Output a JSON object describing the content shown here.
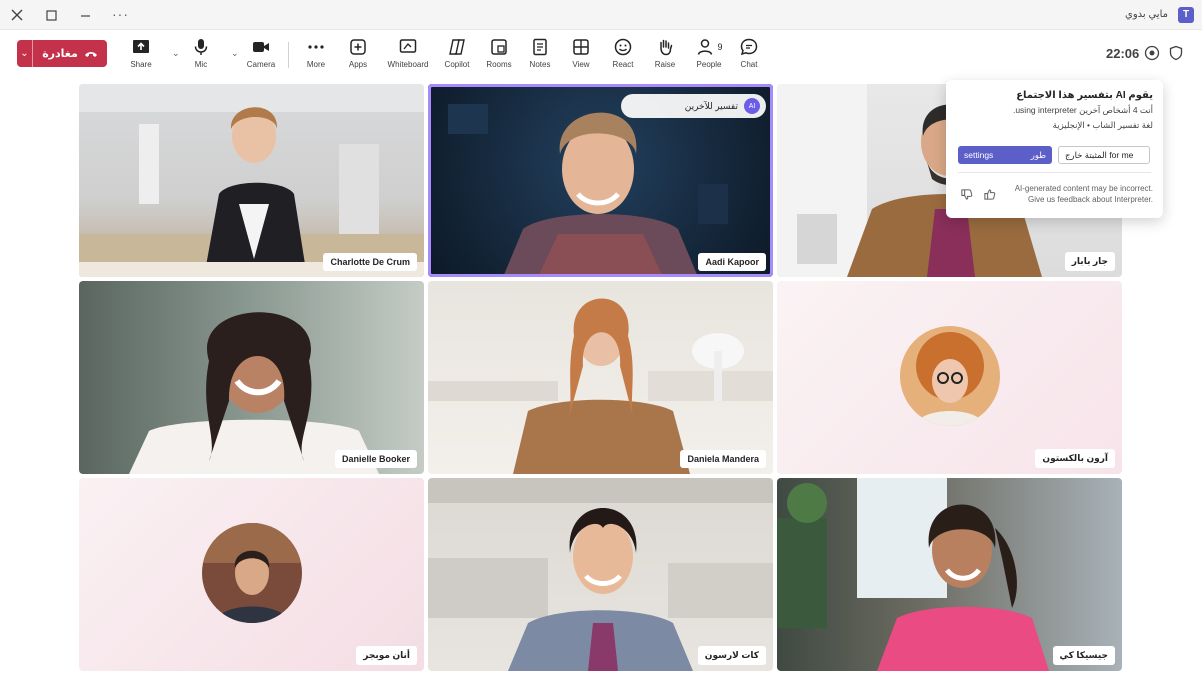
{
  "window": {
    "title": "مايي بدوي",
    "more": "···"
  },
  "toolbar": {
    "leave_label": "مغادرة",
    "share": "Share",
    "mic": "Mic",
    "camera": "Camera",
    "more": "More",
    "apps": "Apps",
    "whiteboard": "Whiteboard",
    "copilot": "Copilot",
    "rooms": "Rooms",
    "notes": "Notes",
    "view": "View",
    "react": "React",
    "raise": "Raise",
    "people": "People",
    "people_count": "9",
    "chat": "Chat",
    "timer": "22:06"
  },
  "tiles": [
    {
      "name": "Charlotte De Crum"
    },
    {
      "name": "Aadi Kapoor",
      "interpreter_pill": "تفسير للآخرين",
      "badge": "AI"
    },
    {
      "name": "جار بابار"
    },
    {
      "name": "Danielle Booker"
    },
    {
      "name": "Daniela Mandera"
    },
    {
      "name": "آرون بالكستون"
    },
    {
      "name": "أنان موبجر"
    },
    {
      "name": "كات لارسون"
    },
    {
      "name": "جيسيكا كي"
    }
  ],
  "popup": {
    "title": "يقوم AI بتفسير هذا الاجتماع",
    "line1": "أنت 4 أشخاص آخرين using interpreter.",
    "line2": "لغة تفسير الشاب • الإنجليزية",
    "btn_left": "المثبتة خارج for me",
    "btn_right_a": "settings",
    "btn_right_b": "طور",
    "footer": "AI-generated content may be incorrect. Give us feedback about Interpreter."
  },
  "colors": {
    "accent": "#5b5fc7",
    "leave": "#c4314b",
    "active_border": "#a78bfa"
  }
}
